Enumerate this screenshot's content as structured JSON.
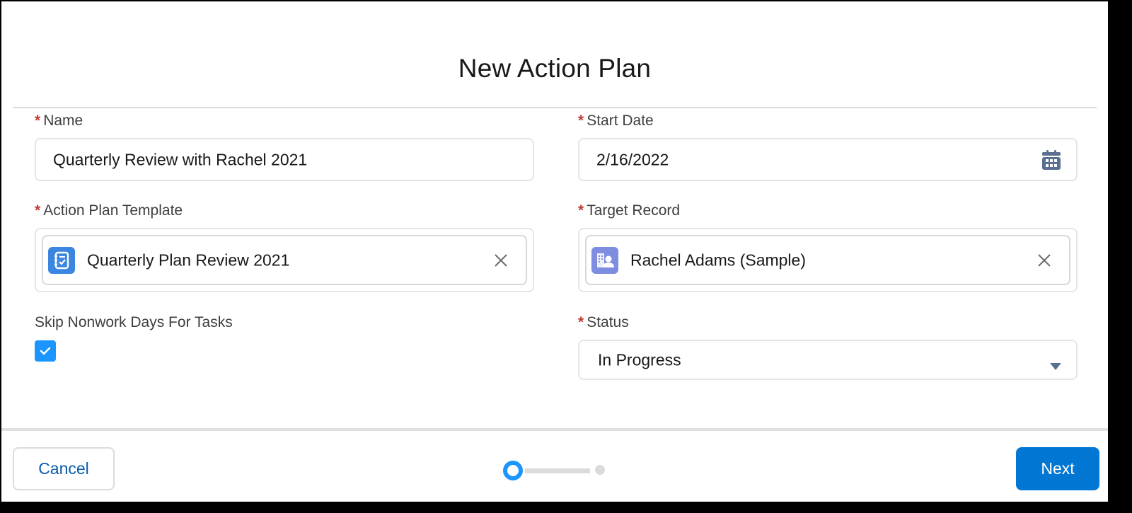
{
  "modal": {
    "title": "New Action Plan"
  },
  "form": {
    "required_marker": "*",
    "name": {
      "label": "Name",
      "required": true,
      "value": "Quarterly Review with Rachel 2021"
    },
    "start_date": {
      "label": "Start Date",
      "required": true,
      "value": "2/16/2022",
      "icon": "calendar-icon"
    },
    "action_plan_template": {
      "label": "Action Plan Template",
      "required": true,
      "selected": "Quarterly Plan Review 2021",
      "icon": "action-plan-template-icon",
      "icon_color": "#3b86e0",
      "clear_icon": "close-icon"
    },
    "target_record": {
      "label": "Target Record",
      "required": true,
      "selected": "Rachel Adams (Sample)",
      "icon": "person-account-icon",
      "icon_color": "#7f8de1",
      "clear_icon": "close-icon"
    },
    "skip_nonwork_days": {
      "label": "Skip Nonwork Days For Tasks",
      "checked": true,
      "color": "#1b96ff"
    },
    "status": {
      "label": "Status",
      "required": true,
      "value": "In Progress",
      "icon": "chevron-down-icon"
    }
  },
  "footer": {
    "cancel_label": "Cancel",
    "next_label": "Next",
    "progress": {
      "current_step": 1,
      "total_steps": 2
    }
  },
  "colors": {
    "brand": "#0176d3",
    "required": "#c23934",
    "progress_active": "#1b96ff",
    "progress_inactive": "#dddbda"
  }
}
